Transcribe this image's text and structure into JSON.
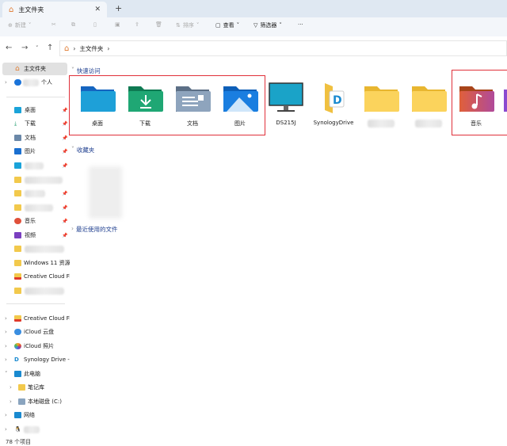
{
  "tab": {
    "title": "主文件夹",
    "close": "✕",
    "new": "+"
  },
  "toolbar": {
    "new": "新建",
    "sort": "排序",
    "view": "查看",
    "filter": "筛选器",
    "more": "···"
  },
  "address": {
    "crumb": "主文件夹"
  },
  "sidebar": {
    "home": "主文件夹",
    "personal": "个人",
    "desktop": "桌面",
    "downloads": "下载",
    "documents": "文档",
    "pictures": "图片",
    "music": "音乐",
    "videos": "视频",
    "win11": "Windows 11 资源",
    "ccf1": "Creative Cloud Fil",
    "ccf2": "Creative Cloud Fil",
    "icloud_drive": "iCloud 云盘",
    "icloud_photos": "iCloud 照片",
    "synology": "Synology Drive -",
    "thispc": "此电脑",
    "notes": "笔记库",
    "localdisk": "本地磁盘 (C:)",
    "network": "网络"
  },
  "content": {
    "quick_access": "快速访问",
    "favorites": "收藏夹",
    "recent": "最近使用的文件",
    "tiles": [
      "桌面",
      "下载",
      "文档",
      "图片",
      "DS215J",
      "SynologyDrive",
      "",
      "",
      "音乐"
    ]
  },
  "status": {
    "count": "78 个项目"
  },
  "colors": {
    "highlight": "#e0303a",
    "accent": "#1f3f8f"
  }
}
